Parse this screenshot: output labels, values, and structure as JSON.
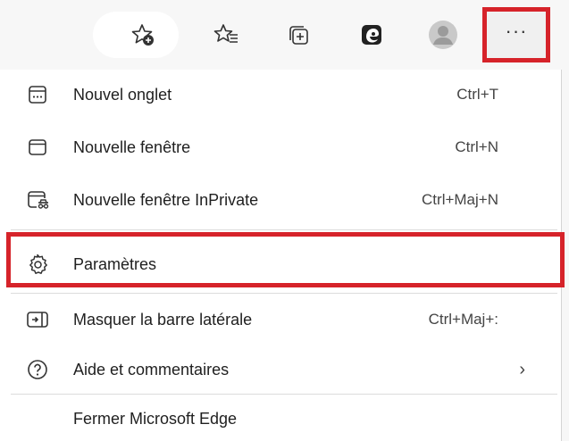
{
  "toolbar": {
    "buttons": [
      {
        "name": "add-favorite",
        "icon": "star-plus-icon"
      },
      {
        "name": "favorites",
        "icon": "favorites-list-icon"
      },
      {
        "name": "collections",
        "icon": "collections-icon"
      },
      {
        "name": "edge-sidebar",
        "icon": "edge-logo-icon"
      },
      {
        "name": "profile",
        "icon": "avatar-icon"
      }
    ],
    "more_label": "···"
  },
  "menu": {
    "items": [
      {
        "label": "Nouvel onglet",
        "shortcut": "Ctrl+T",
        "icon": "new-tab-icon"
      },
      {
        "label": "Nouvelle fenêtre",
        "shortcut": "Ctrl+N",
        "icon": "new-window-icon"
      },
      {
        "label": "Nouvelle fenêtre InPrivate",
        "shortcut": "Ctrl+Maj+N",
        "icon": "inprivate-window-icon"
      },
      {
        "label": "Paramètres",
        "shortcut": "",
        "icon": "gear-icon"
      },
      {
        "label": "Masquer la barre latérale",
        "shortcut": "Ctrl+Maj+:",
        "icon": "sidebar-icon"
      },
      {
        "label": "Aide et commentaires",
        "shortcut": "",
        "icon": "help-icon",
        "chevron": "›"
      },
      {
        "label": "Fermer Microsoft Edge",
        "shortcut": "",
        "icon": ""
      }
    ]
  },
  "colors": {
    "highlight": "#d6232a",
    "toolbar_bg": "#f7f7f7",
    "menu_bg": "#ffffff",
    "text": "#1f1f1f"
  }
}
